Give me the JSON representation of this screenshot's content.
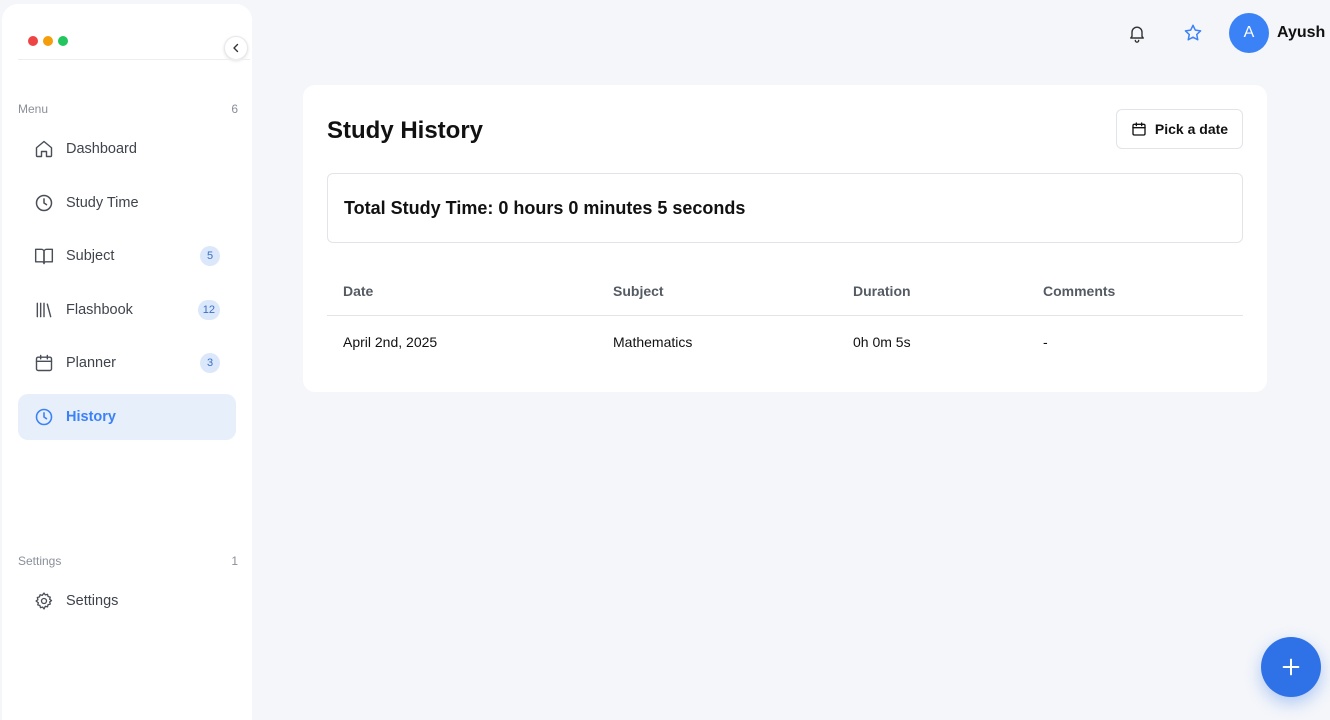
{
  "window_controls": {
    "colors": [
      "#ef4444",
      "#f59e0b",
      "#22c55e"
    ]
  },
  "sidebar": {
    "collapse_icon": "chevron-left-icon",
    "menu_section": {
      "label": "Menu",
      "count": "6"
    },
    "items": [
      {
        "label": "Dashboard",
        "icon": "home-icon",
        "badge": ""
      },
      {
        "label": "Study Time",
        "icon": "clock-icon",
        "badge": ""
      },
      {
        "label": "Subject",
        "icon": "book-open-icon",
        "badge": "5"
      },
      {
        "label": "Flashbook",
        "icon": "library-icon",
        "badge": "12"
      },
      {
        "label": "Planner",
        "icon": "calendar-icon",
        "badge": "3"
      },
      {
        "label": "History",
        "icon": "clock-icon",
        "badge": "",
        "active": true
      }
    ],
    "settings_section": {
      "label": "Settings",
      "count": "1"
    },
    "settings_item": {
      "label": "Settings",
      "icon": "gear-icon"
    }
  },
  "topbar": {
    "notification_icon": "bell-icon",
    "favorite_icon": "star-icon",
    "avatar_initial": "A",
    "username": "Ayush"
  },
  "main": {
    "title": "Study History",
    "date_picker_label": "Pick a date",
    "total_study_time": "Total Study Time: 0 hours 0 minutes 5 seconds",
    "table": {
      "columns": [
        "Date",
        "Subject",
        "Duration",
        "Comments"
      ],
      "rows": [
        [
          "April 2nd, 2025",
          "Mathematics",
          "0h 0m 5s",
          "-"
        ]
      ]
    }
  },
  "fab": {
    "icon": "plus-icon"
  },
  "colors": {
    "accent": "#3b82f6",
    "active_bg": "#e7effb",
    "page_bg": "#f4f6fa"
  }
}
